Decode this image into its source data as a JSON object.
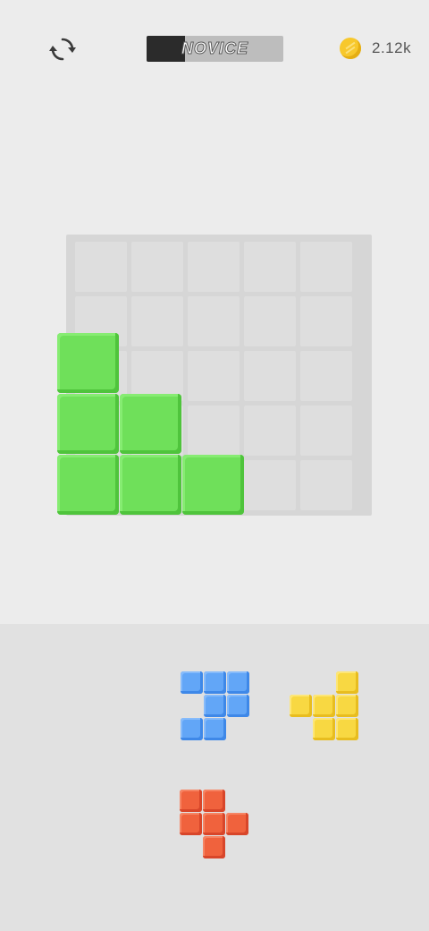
{
  "header": {
    "restart_icon": "restart-icon",
    "level_label": "NOVICE",
    "level_progress": 0.28,
    "coin_icon": "coin-icon",
    "coins": "2.12k"
  },
  "board": {
    "rows": 5,
    "cols": 5,
    "filled_color": "#6fe05a",
    "empty_color": "#dedede",
    "filled_cells": [
      [
        2,
        0
      ],
      [
        3,
        0
      ],
      [
        3,
        1
      ],
      [
        4,
        0
      ],
      [
        4,
        1
      ],
      [
        4,
        2
      ]
    ]
  },
  "tray": {
    "pieces": [
      {
        "name": "blue-piece",
        "color": "blue",
        "cells": [
          [
            0,
            0
          ],
          [
            0,
            1
          ],
          [
            0,
            2
          ],
          [
            1,
            1
          ],
          [
            1,
            2
          ],
          [
            2,
            0
          ],
          [
            2,
            1
          ]
        ]
      },
      {
        "name": "yellow-piece",
        "color": "yellow",
        "cells": [
          [
            0,
            2
          ],
          [
            1,
            0
          ],
          [
            1,
            1
          ],
          [
            1,
            2
          ],
          [
            2,
            1
          ],
          [
            2,
            2
          ]
        ]
      },
      {
        "name": "red-piece",
        "color": "red",
        "cells": [
          [
            0,
            0
          ],
          [
            0,
            1
          ],
          [
            1,
            0
          ],
          [
            1,
            1
          ],
          [
            1,
            2
          ],
          [
            2,
            1
          ]
        ]
      }
    ]
  }
}
